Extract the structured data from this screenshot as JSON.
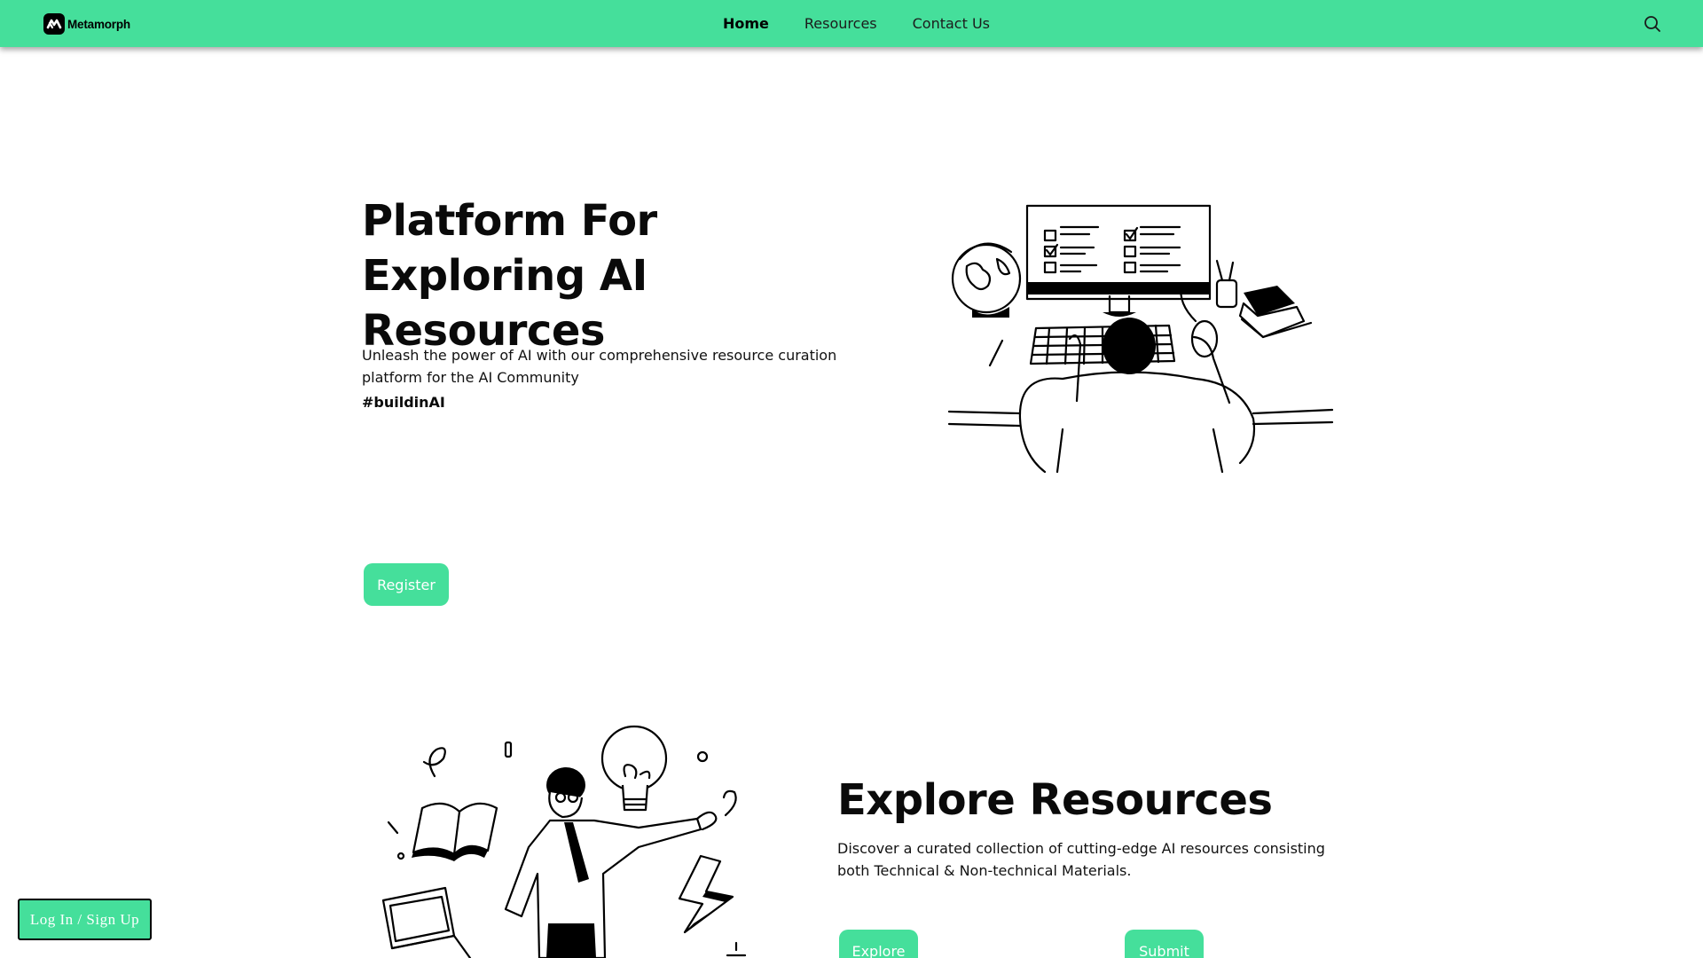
{
  "brand": {
    "name": "Metamorph"
  },
  "nav": {
    "items": [
      {
        "label": "Home",
        "active": true
      },
      {
        "label": "Resources",
        "active": false
      },
      {
        "label": "Contact Us",
        "active": false
      }
    ],
    "search_icon": "search-icon"
  },
  "hero": {
    "title": "Platform For Exploring AI Resources",
    "description": "Unleash the power of AI with our comprehensive resource curation platform for the AI Community",
    "hashtag": "#buildinAI",
    "register_label": "Register"
  },
  "explore": {
    "title": "Explore Resources",
    "description": "Discover a curated collection of cutting-edge AI resources consisting both Technical & Non-technical Materials.",
    "explore_label": "Explore",
    "submit_label": "Submit"
  },
  "login": {
    "label": "Log In / Sign Up"
  },
  "colors": {
    "accent": "#45df9b",
    "text": "#0a0a0a",
    "background": "#ffffff"
  }
}
